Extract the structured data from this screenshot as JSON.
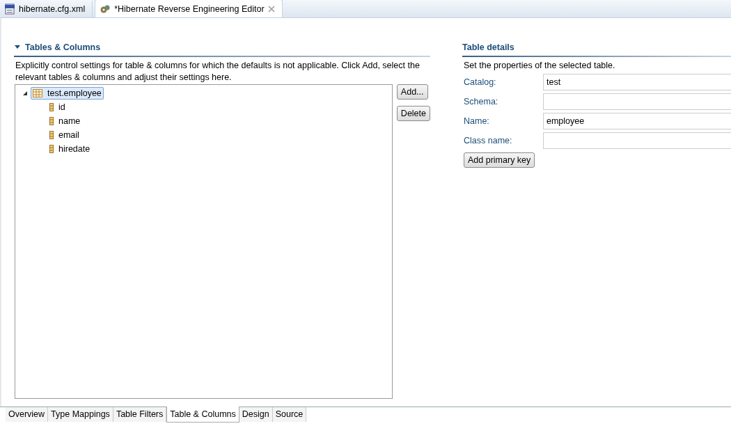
{
  "editor_tabs": [
    {
      "label": "hibernate.cfg.xml",
      "kind": "xml",
      "selected": false,
      "closable": false
    },
    {
      "label": "*Hibernate Reverse Engineering Editor",
      "kind": "reveng",
      "selected": true,
      "closable": true
    }
  ],
  "tables_section": {
    "title": "Tables & Columns",
    "expanded": true,
    "description": "Explicitly control settings for table & columns for which the defaults is not applicable. Click Add, select the relevant tables & columns and adjust their settings here.",
    "tree": [
      {
        "label": "test.employee",
        "kind": "table",
        "selected": true,
        "expanded": true,
        "children": [
          {
            "label": "id",
            "kind": "column",
            "selected": false
          },
          {
            "label": "name",
            "kind": "column",
            "selected": false
          },
          {
            "label": "email",
            "kind": "column",
            "selected": false
          },
          {
            "label": "hiredate",
            "kind": "column",
            "selected": false
          }
        ]
      }
    ],
    "buttons": [
      "Add...",
      "Delete"
    ]
  },
  "details_section": {
    "title": "Table details",
    "description": "Set the properties of the selected table.",
    "fields": [
      {
        "label": "Catalog:",
        "value": "test"
      },
      {
        "label": "Schema:"
      },
      {
        "label": "Name:",
        "value": "employee"
      },
      {
        "label": "Class name:"
      }
    ],
    "button": "Add primary key"
  },
  "page_tabs": [
    {
      "label": "Overview",
      "selected": false
    },
    {
      "label": "Type Mappings",
      "selected": false
    },
    {
      "label": "Table Filters",
      "selected": false
    },
    {
      "label": "Table & Columns",
      "selected": true
    },
    {
      "label": "Design",
      "selected": false
    },
    {
      "label": "Source",
      "selected": false
    }
  ]
}
